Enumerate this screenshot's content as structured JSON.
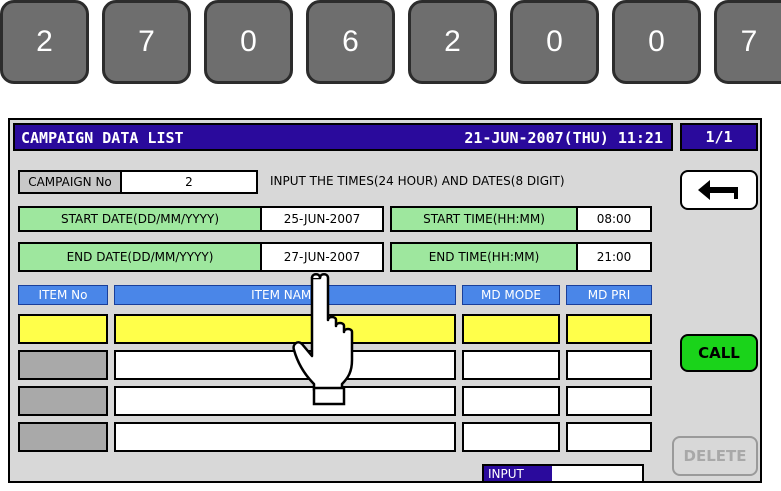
{
  "digits": [
    "2",
    "7",
    "0",
    "6",
    "2",
    "0",
    "0",
    "7"
  ],
  "screen": {
    "title": "CAMPAIGN DATA LIST",
    "datetime": "21-JUN-2007(THU) 11:21",
    "page": "1/1"
  },
  "campaign": {
    "label": "CAMPAIGN No",
    "value": "2"
  },
  "instruction": "INPUT THE TIMES(24 HOUR) AND DATES(8 DIGIT)",
  "start_date": {
    "label": "START DATE(DD/MM/YYYY)",
    "value": "25-JUN-2007"
  },
  "start_time": {
    "label": "START TIME(HH:MM)",
    "value": "08:00"
  },
  "end_date": {
    "label": "END DATE(DD/MM/YYYY)",
    "value": "27-JUN-2007"
  },
  "end_time": {
    "label": "END TIME(HH:MM)",
    "value": "21:00"
  },
  "table": {
    "headers": [
      "ITEM No",
      "ITEM NAME",
      "MD MODE",
      "MD PRI"
    ]
  },
  "buttons": {
    "call": "CALL",
    "delete": "DELETE",
    "back_icon": "return-arrow-icon"
  },
  "status": {
    "input_label": "INPUT"
  },
  "colors": {
    "title_bg": "#2a0a9c",
    "header_bg": "#4a86e8",
    "selected_row": "#ffff4a",
    "call_bg": "#1ad31a",
    "label_green": "#9ee79e"
  }
}
